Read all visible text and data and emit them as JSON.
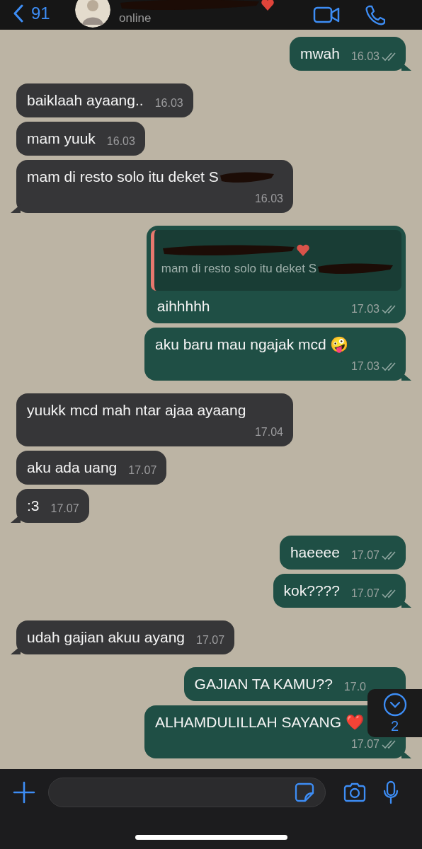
{
  "header": {
    "back_count": "91",
    "name_redacted": true,
    "status": "online"
  },
  "messages": [
    {
      "outgoing": true,
      "text": "mwah",
      "time": "16.03",
      "read": true,
      "tail": true
    },
    {
      "outgoing": false,
      "text": "baiklaah ayaang..",
      "time": "16.03",
      "tail": false
    },
    {
      "outgoing": false,
      "text": "mam yuuk",
      "time": "16.03",
      "tail": false
    },
    {
      "outgoing": false,
      "text": "mam di resto solo itu deket S",
      "redacted": true,
      "time": "16.03",
      "tail": true
    },
    {
      "outgoing": true,
      "quote": {
        "author_redacted": true,
        "text": "mam di resto solo itu deket S",
        "redacted": true
      },
      "text": "aihhhhh",
      "time": "17.03",
      "read": true,
      "tail": false
    },
    {
      "outgoing": true,
      "text": "aku baru mau ngajak mcd 🤪",
      "time": "17.03",
      "read": true,
      "tail": true
    },
    {
      "outgoing": false,
      "text": "yuukk mcd mah ntar ajaa ayaang",
      "time": "17.04",
      "tail": false
    },
    {
      "outgoing": false,
      "text": "aku ada uang",
      "time": "17.07",
      "tail": false
    },
    {
      "outgoing": false,
      "text": ":3",
      "time": "17.07",
      "tail": true
    },
    {
      "outgoing": true,
      "text": "haeeee",
      "time": "17.07",
      "read": true,
      "tail": false
    },
    {
      "outgoing": true,
      "text": "kok????",
      "time": "17.07",
      "read": true,
      "tail": true
    },
    {
      "outgoing": false,
      "text": "udah gajian akuu ayang",
      "time": "17.07",
      "tail": true
    },
    {
      "outgoing": true,
      "text": "GAJIAN TA KAMU??",
      "time": "17.0",
      "read": false,
      "tail": false
    },
    {
      "outgoing": true,
      "text": "ALHAMDULILLAH SAYANG ❤️",
      "time": "17.07",
      "read": true,
      "tail": true
    }
  ],
  "scroll_button": {
    "count": "2"
  }
}
